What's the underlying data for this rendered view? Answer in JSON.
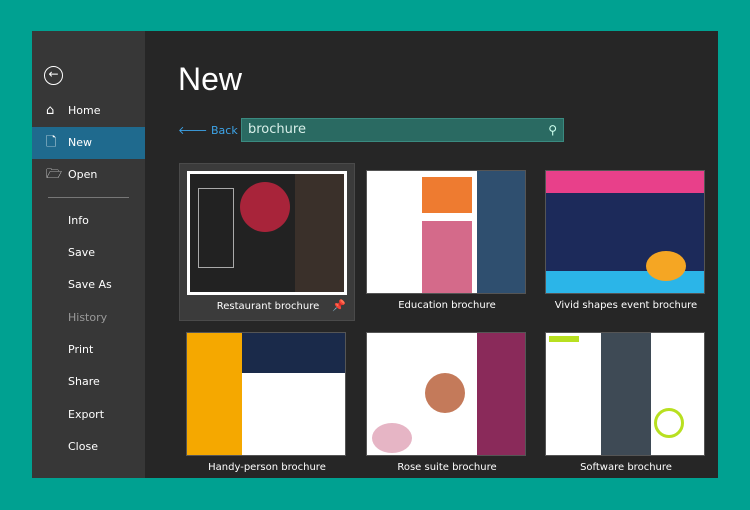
{
  "sidebar": {
    "items": [
      {
        "label": "Home",
        "icon": "home-icon"
      },
      {
        "label": "New",
        "icon": "new-document-icon",
        "selected": true
      },
      {
        "label": "Open",
        "icon": "folder-open-icon"
      },
      {
        "label": "Info"
      },
      {
        "label": "Save"
      },
      {
        "label": "Save As"
      },
      {
        "label": "History",
        "disabled": true
      },
      {
        "label": "Print"
      },
      {
        "label": "Share"
      },
      {
        "label": "Export"
      },
      {
        "label": "Close"
      }
    ]
  },
  "main": {
    "title": "New",
    "back_label": "Back",
    "search_value": "brochure",
    "templates": [
      {
        "label": "Restaurant brochure",
        "pinned": true
      },
      {
        "label": "Education brochure"
      },
      {
        "label": "Vivid shapes event brochure"
      },
      {
        "label": "Handy-person brochure"
      },
      {
        "label": "Rose suite brochure"
      },
      {
        "label": "Software brochure"
      }
    ]
  },
  "colors": {
    "accent": "#00a191",
    "selected": "#1f6a8e",
    "search": "#2a6a62",
    "link": "#3da4e8"
  }
}
